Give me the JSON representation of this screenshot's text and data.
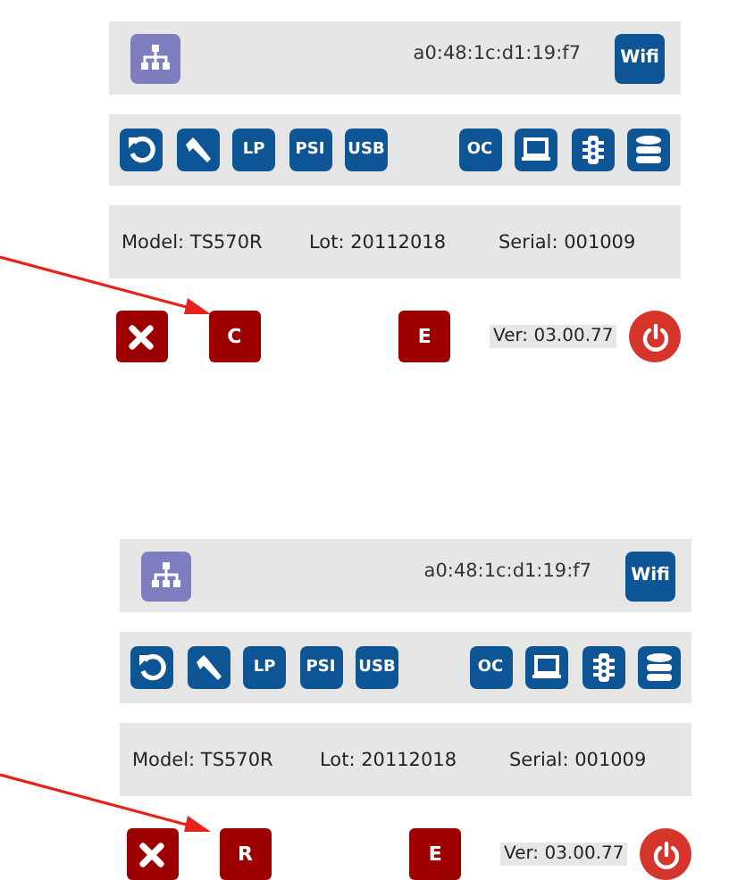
{
  "panels": [
    {
      "mac": "a0:48:1c:d1:19:f7",
      "wifi_label": "Wifi",
      "annotation_arrow": true,
      "tools_left": [
        {
          "kind": "refresh"
        },
        {
          "kind": "caliper"
        },
        {
          "kind": "text",
          "label": "LP"
        },
        {
          "kind": "text",
          "label": "PSI"
        },
        {
          "kind": "text",
          "label": "USB"
        }
      ],
      "tools_right": [
        {
          "kind": "text",
          "label": "OC"
        },
        {
          "kind": "laptop"
        },
        {
          "kind": "traffic"
        },
        {
          "kind": "database"
        }
      ],
      "info": [
        "Model: TS570R",
        "Lot: 20112018",
        "Serial: 001009"
      ],
      "buttons": [
        {
          "kind": "close"
        },
        {
          "kind": "text",
          "label": "C"
        },
        {
          "kind": "spacer"
        },
        {
          "kind": "text",
          "label": "E"
        }
      ],
      "version": "Ver: 03.00.77"
    },
    {
      "mac": "a0:48:1c:d1:19:f7",
      "wifi_label": "Wifi",
      "annotation_arrow": true,
      "tools_left": [
        {
          "kind": "refresh"
        },
        {
          "kind": "caliper"
        },
        {
          "kind": "text",
          "label": "LP"
        },
        {
          "kind": "text",
          "label": "PSI"
        },
        {
          "kind": "text",
          "label": "USB"
        }
      ],
      "tools_right": [
        {
          "kind": "text",
          "label": "OC"
        },
        {
          "kind": "laptop"
        },
        {
          "kind": "traffic"
        },
        {
          "kind": "database"
        }
      ],
      "info": [
        "Model: TS570R",
        "Lot: 20112018",
        "Serial: 001009"
      ],
      "buttons": [
        {
          "kind": "close"
        },
        {
          "kind": "text",
          "label": "R"
        },
        {
          "kind": "spacer"
        },
        {
          "kind": "text",
          "label": "E"
        }
      ],
      "version": "Ver: 03.00.77"
    }
  ]
}
